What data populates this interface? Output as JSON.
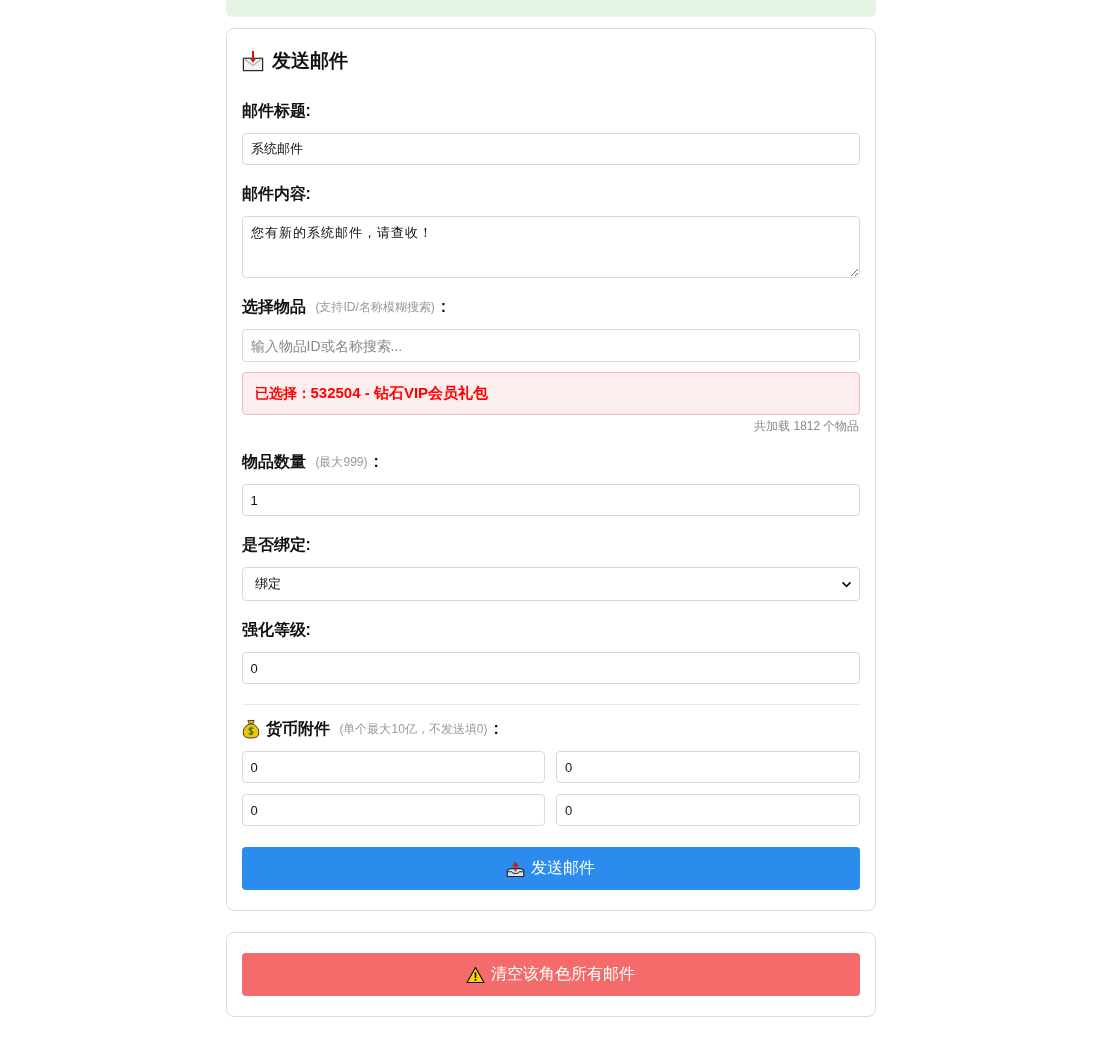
{
  "mail_form": {
    "title": "发送邮件",
    "fields": [
      {
        "kind": "text",
        "label": "邮件标题:",
        "value": "系统邮件"
      },
      {
        "kind": "textarea",
        "label": "邮件内容:",
        "value": "您有新的系统邮件，请查收！"
      },
      {
        "kind": "search",
        "label": "选择物品",
        "hint": "(支持ID/名称模糊搜索)",
        "suffix": ":",
        "placeholder": "输入物品ID或名称搜索...",
        "chosen": {
          "label": "已选择：",
          "value": "532504 - 钻石VIP会员礼包"
        },
        "count": "共加载 1812 个物品"
      },
      {
        "kind": "text",
        "label": "物品数量",
        "hint": "(最大999)",
        "suffix": ":",
        "value": "1"
      },
      {
        "kind": "select",
        "label": "是否绑定:",
        "value": "绑定"
      },
      {
        "kind": "text",
        "label": "强化等级:",
        "value": "0"
      }
    ],
    "currency": {
      "label": "货币附件",
      "hint": "(单个最大10亿，不发送填0)",
      "suffix": ":",
      "values": [
        "0",
        "0",
        "0",
        "0"
      ]
    },
    "submit_button": "发送邮件"
  },
  "danger_zone": {
    "button": "清空该角色所有邮件"
  }
}
